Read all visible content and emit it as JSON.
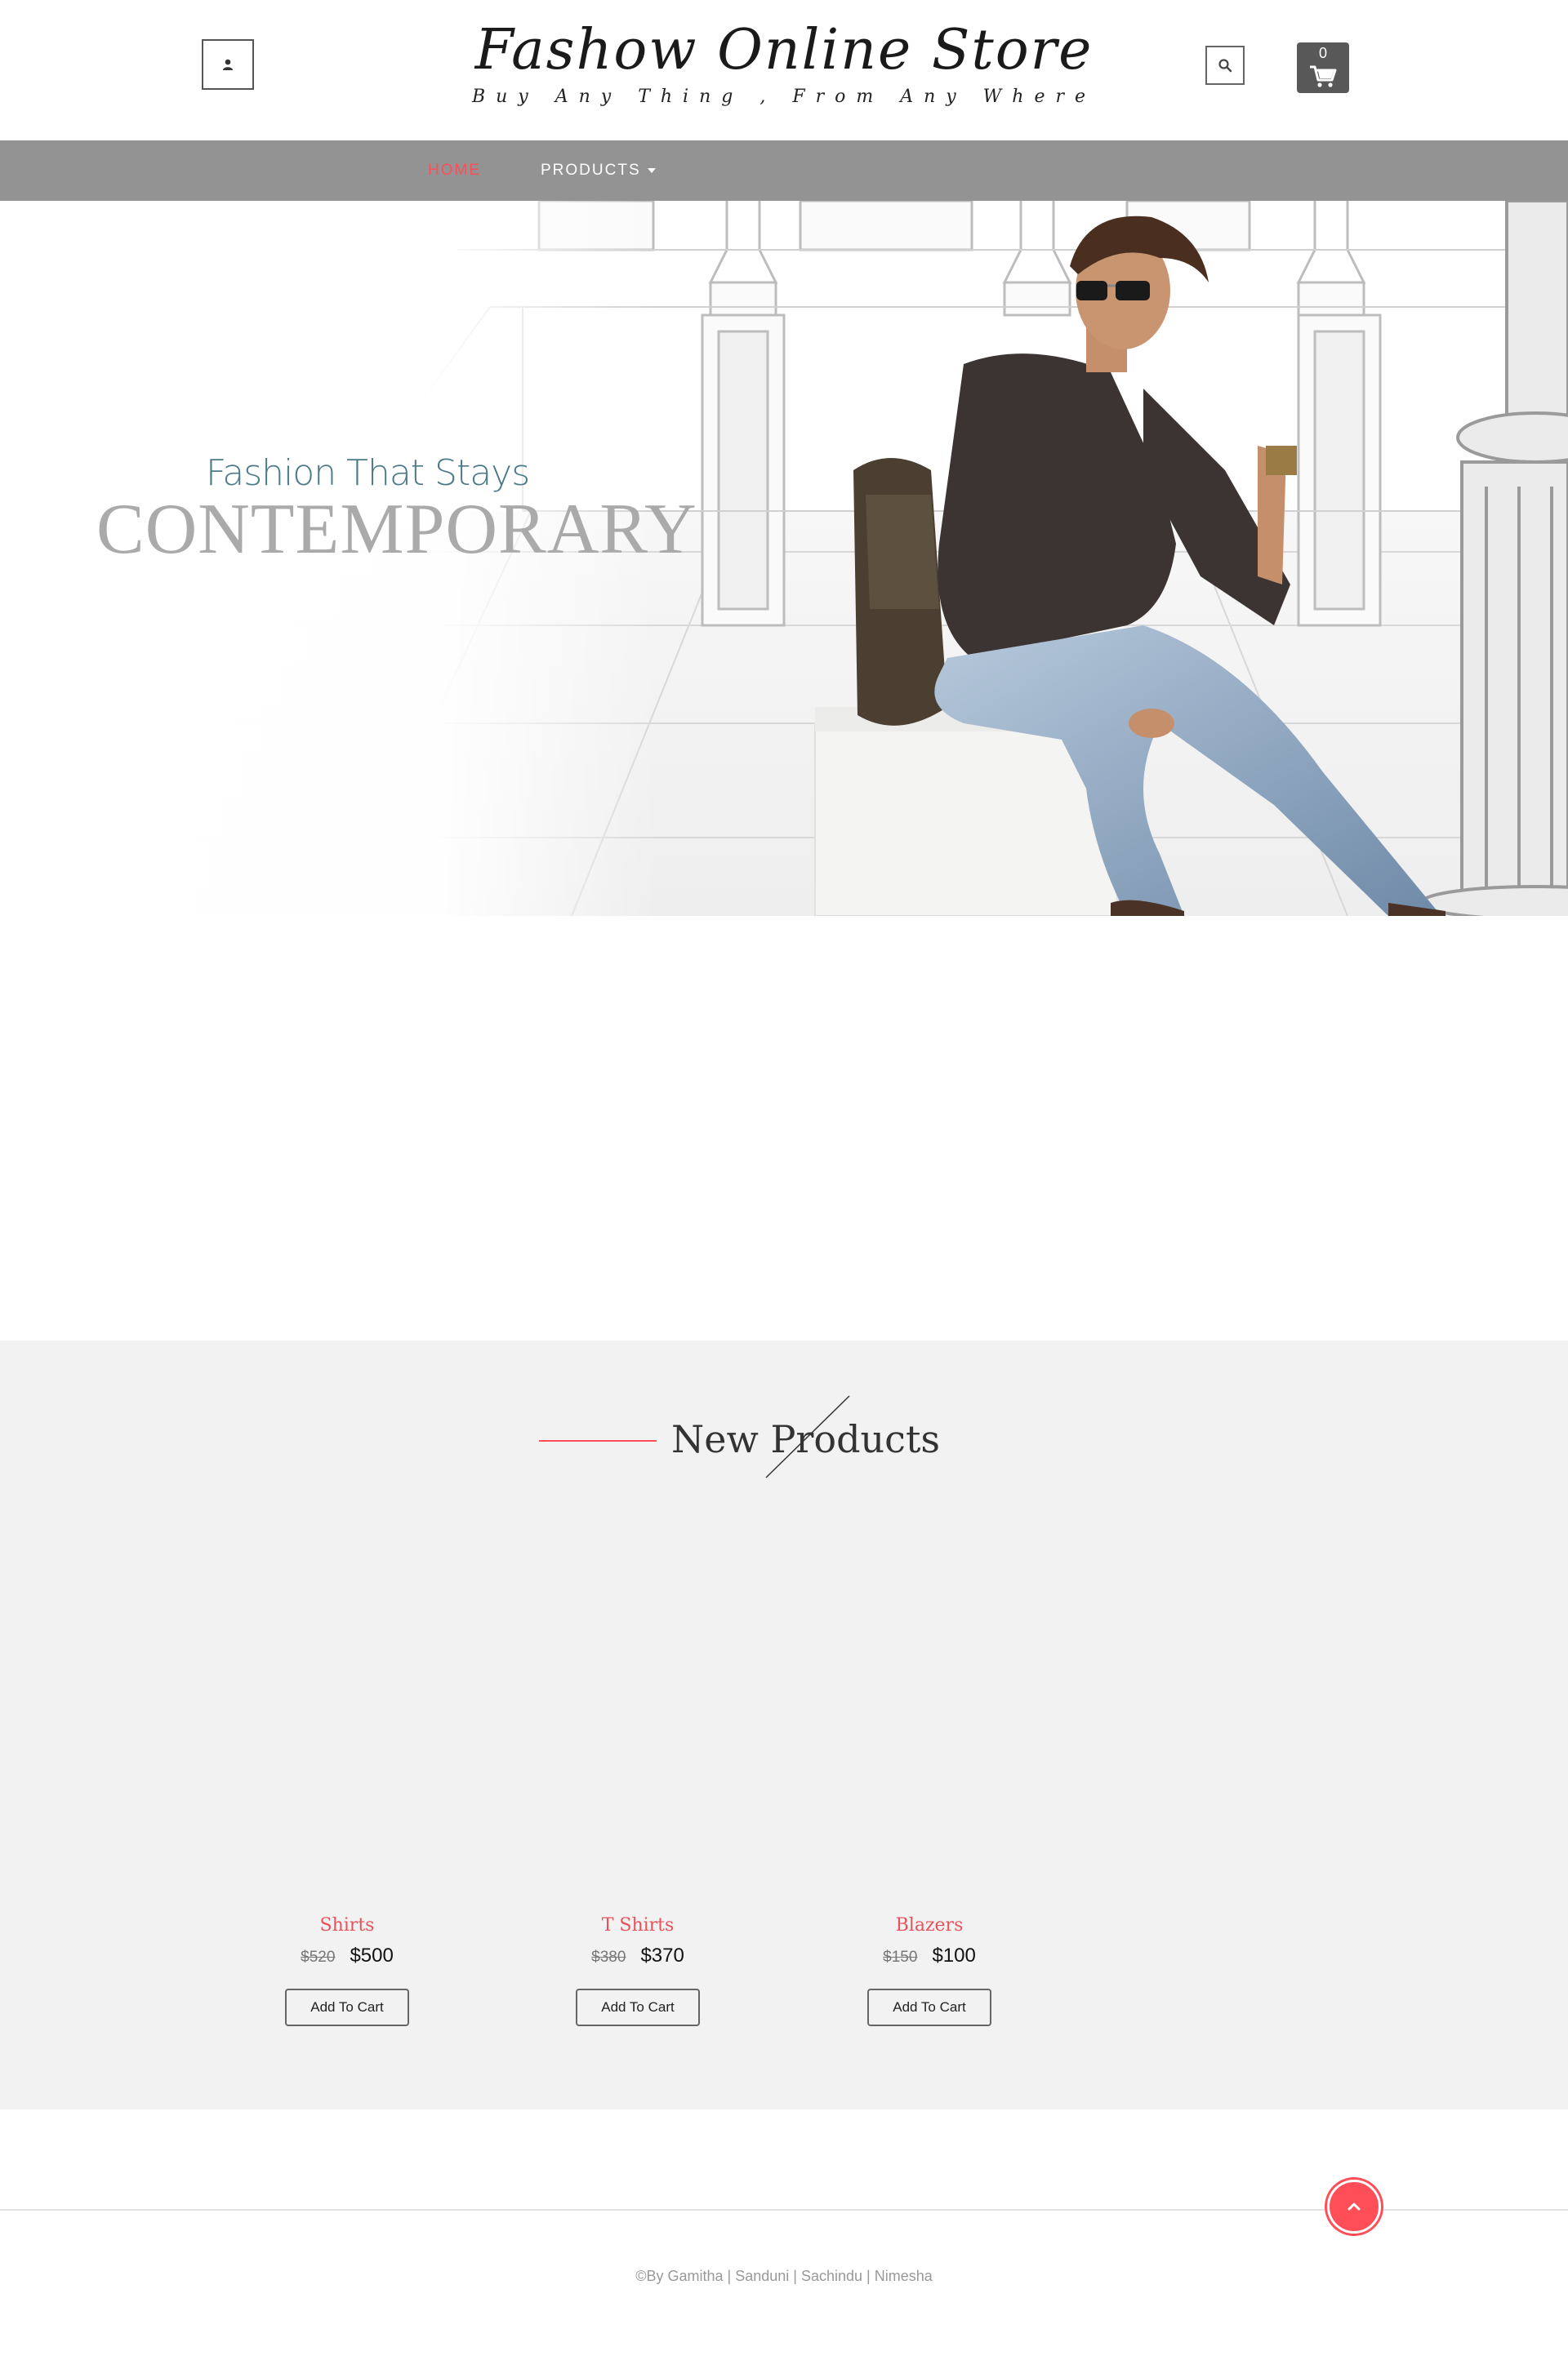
{
  "header": {
    "brand_title": "Fashow Online Store",
    "brand_tagline": "Buy Any Thing , From Any Where",
    "user_icon": "user-icon",
    "search_icon": "search-icon",
    "cart": {
      "count": "0",
      "icon": "cart-icon"
    }
  },
  "nav": {
    "items": [
      {
        "label": "HOME",
        "active": true
      },
      {
        "label": "PRODUCTS",
        "dropdown": true
      }
    ],
    "active_color": "#ff4e57",
    "bar_color": "#939393"
  },
  "hero": {
    "subtitle": "Fashion That Stays",
    "title": "CONTEMPORARY"
  },
  "new_products": {
    "title": "New Products",
    "items": [
      {
        "name": "Shirts",
        "old_price": "$520",
        "price": "$500",
        "button": "Add To Cart"
      },
      {
        "name": "T Shirts",
        "old_price": "$380",
        "price": "$370",
        "button": "Add To Cart"
      },
      {
        "name": "Blazers",
        "old_price": "$150",
        "price": "$100",
        "button": "Add To Cart"
      }
    ]
  },
  "footer": {
    "credits": "©By Gamitha | Sanduni | Sachindu | Nimesha",
    "back_to_top_icon": "chevron-up-icon"
  },
  "colors": {
    "accent": "#ff4e57",
    "section_bg": "#f2f2f2"
  }
}
